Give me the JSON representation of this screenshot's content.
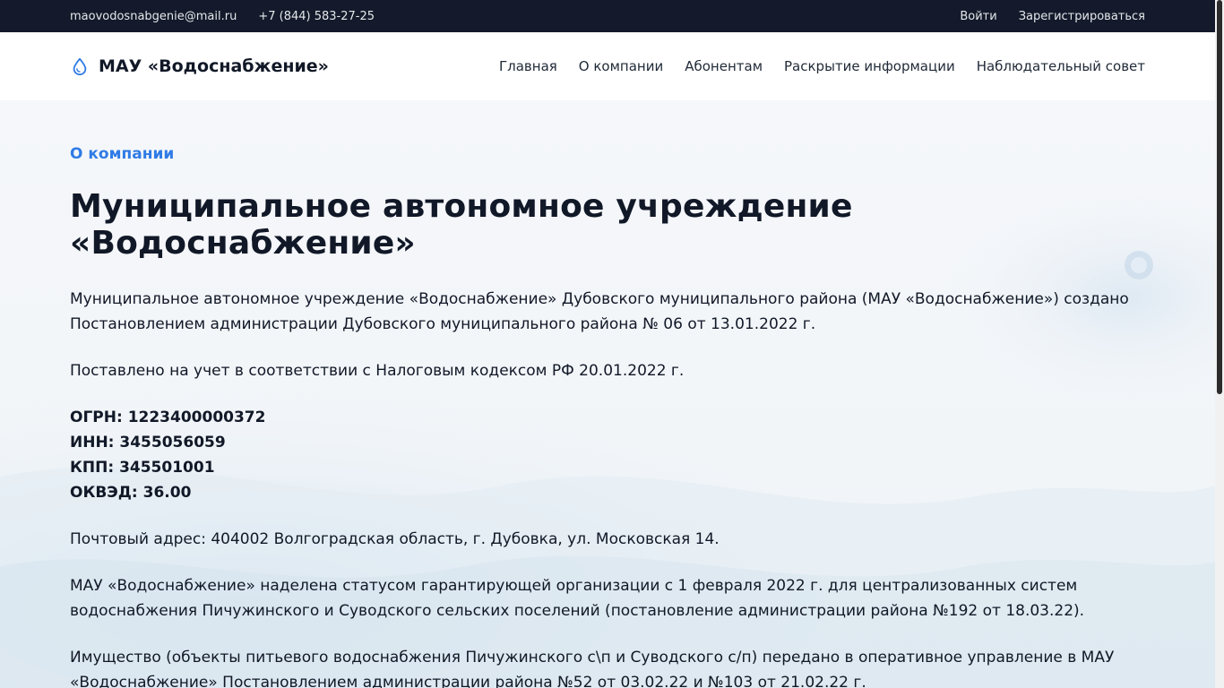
{
  "topbar": {
    "email": "maovodosnabgenie@mail.ru",
    "phone": "+7 (844) 583-27-25",
    "login": "Войти",
    "register": "Зарегистрироваться"
  },
  "header": {
    "brand": "МАУ «Водоснабжение»",
    "nav": [
      "Главная",
      "О компании",
      "Абонентам",
      "Раскрытие информации",
      "Наблюдательный совет"
    ]
  },
  "page": {
    "breadcrumb": "О компании",
    "title": "Муниципальное автономное учреждение «Водоснабжение»",
    "p1": "Муниципальное автономное учреждение «Водоснабжение» Дубовского муниципального района (МАУ «Водоснабжение») создано Постановлением администрации Дубовского муниципального района № 06 от 13.01.2022 г.",
    "p2": "Поставлено на учет в соответствии с Налоговым кодексом РФ 20.01.2022 г.",
    "reqs": [
      "ОГРН: 1223400000372",
      "ИНН: 3455056059",
      "КПП: 345501001",
      "ОКВЭД: 36.00"
    ],
    "p3": "Почтовый адрес: 404002 Волгоградская область, г. Дубовка, ул. Московская 14.",
    "p4": "МАУ «Водоснабжение» наделена статусом гарантирующей организации с 1 февраля 2022 г. для централизованных систем водоснабжения Пичужинского и Суводского сельских поселений (постановление администрации района №192 от 18.03.22).",
    "p5": "Имущество (объекты питьевого водоснабжения Пичужинского с\\п и Суводского с/п) передано в оперативное управление в МАУ «Водоснабжение» Постановлением администрации района №52 от 03.02.22 и №103 от 21.02.22 г."
  },
  "colors": {
    "topbar": "#141a2b",
    "accent": "#2f7be6",
    "text": "#111827"
  },
  "icons": {
    "brand": "water-drop-icon"
  }
}
